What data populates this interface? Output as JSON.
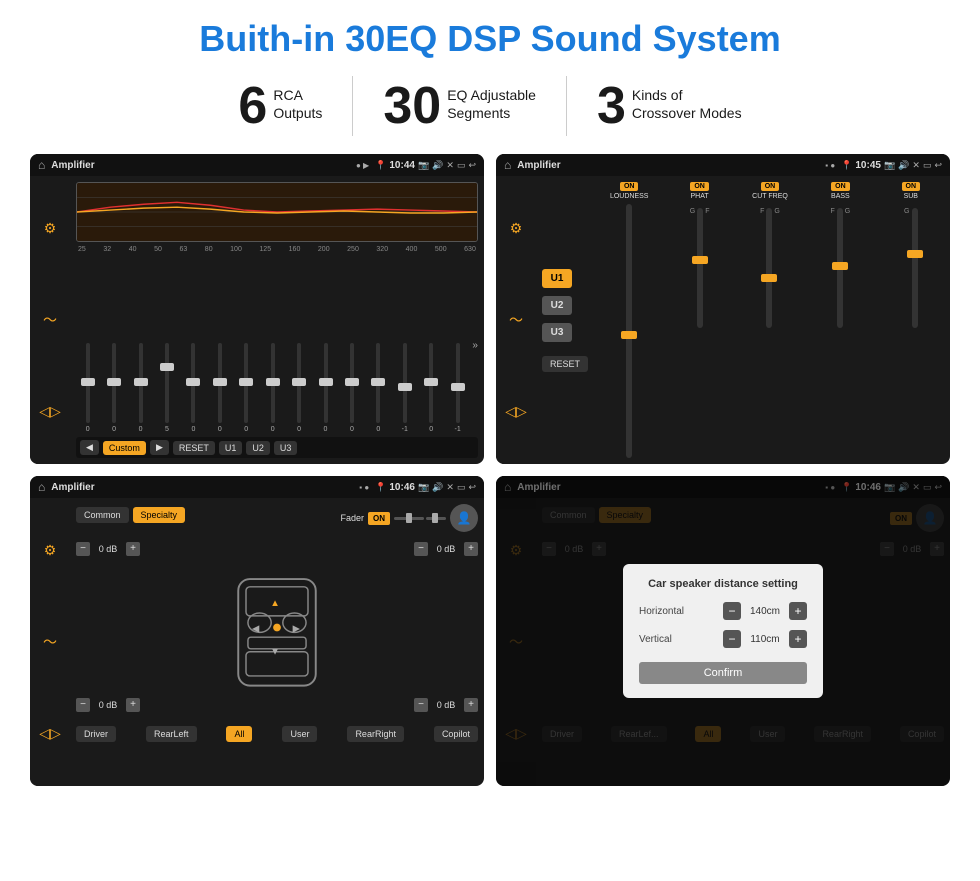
{
  "header": {
    "title": "Buith-in 30EQ DSP Sound System"
  },
  "features": [
    {
      "number": "6",
      "line1": "RCA",
      "line2": "Outputs"
    },
    {
      "number": "30",
      "line1": "EQ Adjustable",
      "line2": "Segments"
    },
    {
      "number": "3",
      "line1": "Kinds of",
      "line2": "Crossover Modes"
    }
  ],
  "screens": {
    "eq": {
      "title": "Amplifier",
      "time": "10:44",
      "freqs": [
        "25",
        "32",
        "40",
        "50",
        "63",
        "80",
        "100",
        "125",
        "160",
        "200",
        "250",
        "320",
        "400",
        "500",
        "630"
      ],
      "values": [
        "0",
        "0",
        "0",
        "5",
        "0",
        "0",
        "0",
        "0",
        "0",
        "0",
        "0",
        "0",
        "-1",
        "0",
        "-1"
      ],
      "buttons": [
        "Custom",
        "RESET",
        "U1",
        "U2",
        "U3"
      ]
    },
    "crossover": {
      "title": "Amplifier",
      "time": "10:45",
      "u_buttons": [
        "U1",
        "U2",
        "U3"
      ],
      "channels": [
        "LOUDNESS",
        "PHAT",
        "CUT FREQ",
        "BASS",
        "SUB"
      ],
      "reset_label": "RESET"
    },
    "fader": {
      "title": "Amplifier",
      "time": "10:46",
      "tabs": [
        "Common",
        "Specialty"
      ],
      "fader_label": "Fader",
      "on_label": "ON",
      "db_labels": [
        "0 dB",
        "0 dB",
        "0 dB",
        "0 dB"
      ],
      "buttons": [
        "Driver",
        "RearLeft",
        "All",
        "User",
        "RearRight",
        "Copilot"
      ]
    },
    "distance": {
      "title": "Amplifier",
      "time": "10:46",
      "dialog": {
        "title": "Car speaker distance setting",
        "horizontal_label": "Horizontal",
        "horizontal_value": "140cm",
        "vertical_label": "Vertical",
        "vertical_value": "110cm",
        "confirm_label": "Confirm"
      },
      "buttons": [
        "Driver",
        "RearLeft",
        "All",
        "User",
        "RearRight",
        "Copilot"
      ]
    }
  },
  "colors": {
    "accent": "#1a7bdb",
    "orange": "#f5a623",
    "dark_bg": "#1a1a1a"
  }
}
